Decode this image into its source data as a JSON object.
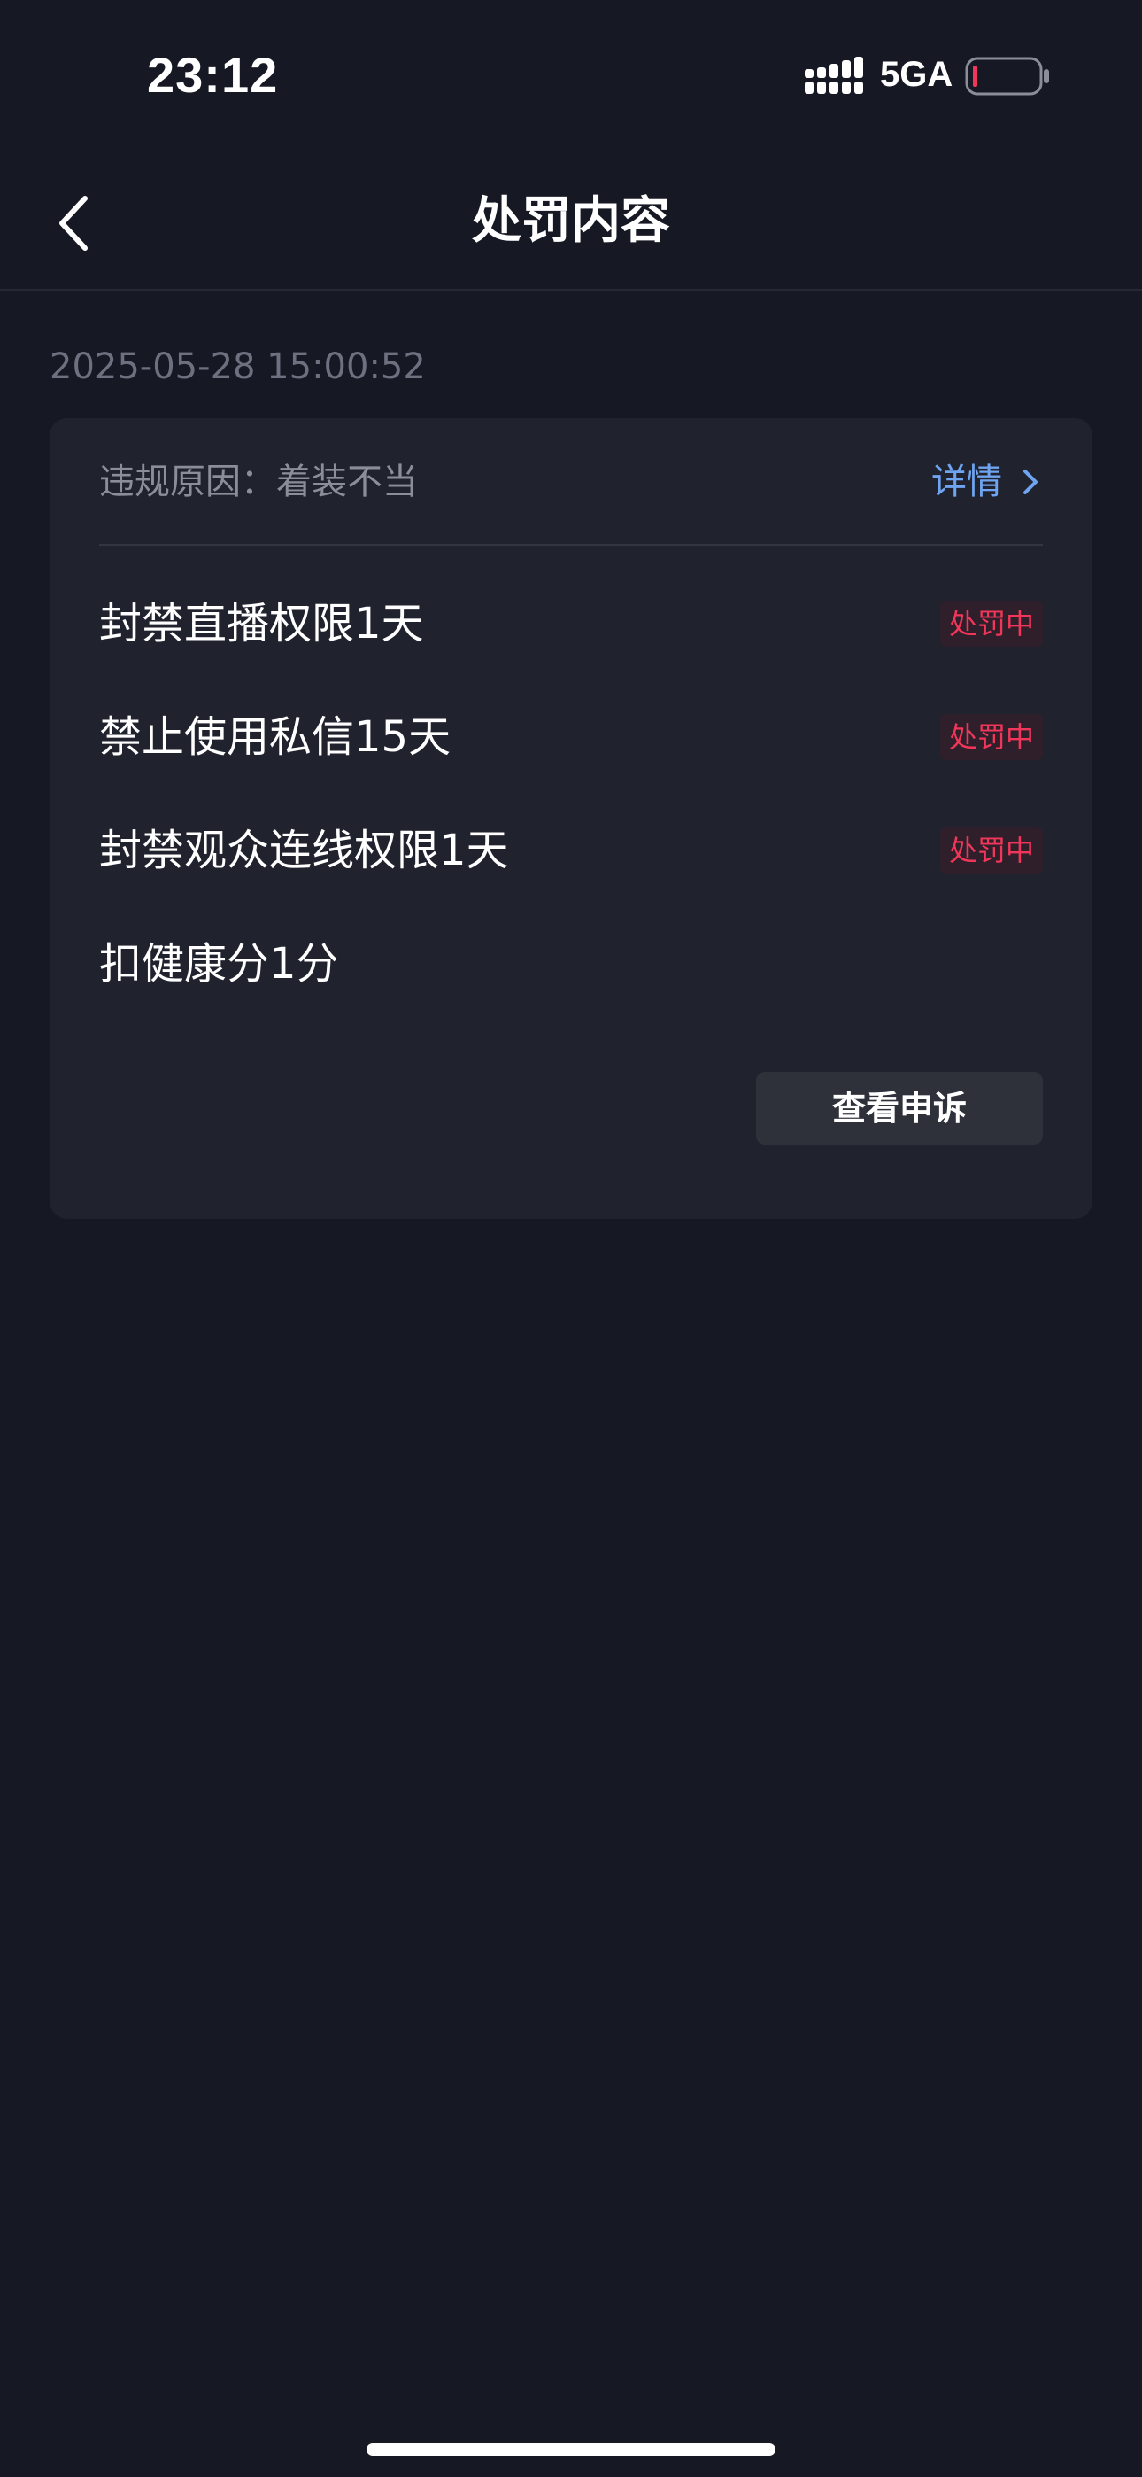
{
  "status_bar": {
    "time": "23:12",
    "network": "5GA",
    "signal_icon": "signal-bars-icon",
    "battery_icon": "battery-low-icon",
    "battery_level": 0.05
  },
  "nav": {
    "title": "处罚内容",
    "back_icon": "chevron-left-icon"
  },
  "timestamp": "2025-05-28 15:00:52",
  "card": {
    "reason": "违规原因：着装不当",
    "detail_label": "详情",
    "detail_icon": "chevron-right-icon",
    "penalties": [
      {
        "label": "封禁直播权限1天",
        "status": "处罚中"
      },
      {
        "label": "禁止使用私信15天",
        "status": "处罚中"
      },
      {
        "label": "封禁观众连线权限1天",
        "status": "处罚中"
      },
      {
        "label": "扣健康分1分",
        "status": ""
      }
    ],
    "appeal_button": "查看申诉"
  },
  "colors": {
    "background": "#161823",
    "card": "#20222e",
    "link": "#6fa4f0",
    "status_red": "#f2365a",
    "muted_text": "#6e7080"
  }
}
